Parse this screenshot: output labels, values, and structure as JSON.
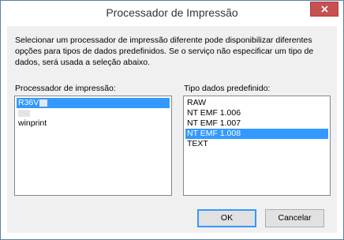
{
  "window": {
    "title": "Processador de Impressão"
  },
  "description": "Selecionar um processador de impressão diferente pode disponibilizar diferentes opções para tipos de dados predefinidos. Se o serviço não especificar um tipo de dados, será usada a seleção abaixo.",
  "processors": {
    "label": "Processador de impressão:",
    "items": [
      {
        "label": "R36V",
        "selected": true
      },
      {
        "label": "",
        "selected": false
      },
      {
        "label": "winprint",
        "selected": false
      }
    ]
  },
  "datatypes": {
    "label": "Tipo dados predefinido:",
    "items": [
      {
        "label": "RAW",
        "selected": false
      },
      {
        "label": "NT EMF 1.006",
        "selected": false
      },
      {
        "label": "NT EMF 1.007",
        "selected": false
      },
      {
        "label": "NT EMF 1.008",
        "selected": true
      },
      {
        "label": "TEXT",
        "selected": false
      }
    ]
  },
  "buttons": {
    "ok": "OK",
    "cancel": "Cancelar"
  },
  "colors": {
    "selection": "#3399ff",
    "close": "#c75050",
    "dialog_bg": "#f0f0f0"
  },
  "icons": {
    "close": "close-icon"
  }
}
